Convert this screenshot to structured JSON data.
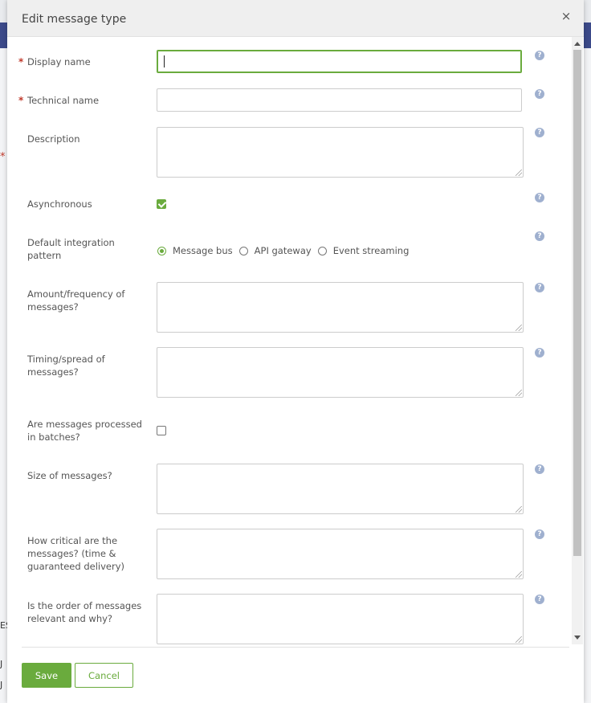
{
  "dialog": {
    "title": "Edit message type",
    "close_symbol": "×",
    "required_marker": "*"
  },
  "background": {
    "required_marker": "*",
    "glyphs": [
      "ES",
      "J",
      "J"
    ]
  },
  "fields": {
    "display_name": {
      "label": "Display name",
      "value": "",
      "required": true
    },
    "technical_name": {
      "label": "Technical name",
      "value": "",
      "required": true
    },
    "description": {
      "label": "Description",
      "value": ""
    },
    "asynchronous": {
      "label": "Asynchronous",
      "checked": true
    },
    "integration_pattern": {
      "label": "Default integration pattern",
      "options": [
        "Message bus",
        "API gateway",
        "Event streaming"
      ],
      "selected": "Message bus"
    },
    "amount_frequency": {
      "label": "Amount/frequency of messages?",
      "value": ""
    },
    "timing_spread": {
      "label": "Timing/spread of messages?",
      "value": ""
    },
    "batches": {
      "label": "Are messages processed in batches?",
      "checked": false
    },
    "size": {
      "label": "Size of messages?",
      "value": ""
    },
    "critical": {
      "label": "How critical are the messages? (time & guaranteed delivery)",
      "value": ""
    },
    "order": {
      "label": "Is the order of messages relevant and why?",
      "value": ""
    }
  },
  "help_icon": {
    "icon": "help-circle-icon",
    "glyph": "?"
  },
  "buttons": {
    "save": "Save",
    "cancel": "Cancel"
  },
  "colors": {
    "accent": "#6aab3d",
    "required": "#c0392b",
    "help": "#9fb0cf"
  }
}
